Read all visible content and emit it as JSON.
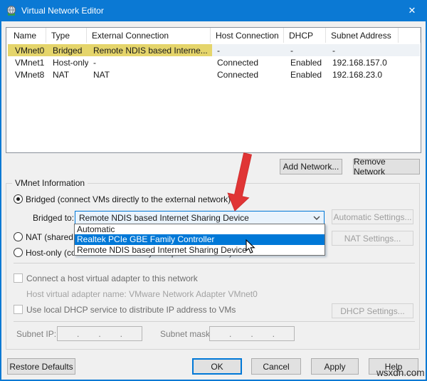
{
  "window": {
    "title": "Virtual Network Editor",
    "close_glyph": "✕"
  },
  "colors": {
    "titlebar": "#0b79d4",
    "selection_yellow": "#e5d56b",
    "selection_inactive": "#eef2f6",
    "highlight_blue": "#0078d7",
    "arrow_red": "#e03535"
  },
  "table": {
    "columns": [
      "Name",
      "Type",
      "External Connection",
      "Host Connection",
      "DHCP",
      "Subnet Address"
    ],
    "rows": [
      [
        "VMnet0",
        "Bridged",
        "Remote NDIS based Interne...",
        "-",
        "-",
        "-"
      ],
      [
        "VMnet1",
        "Host-only",
        "-",
        "Connected",
        "Enabled",
        "192.168.157.0"
      ],
      [
        "VMnet8",
        "NAT",
        "NAT",
        "Connected",
        "Enabled",
        "192.168.23.0"
      ]
    ]
  },
  "actions": {
    "add_network": "Add Network...",
    "remove_network": "Remove Network"
  },
  "vmnet": {
    "group_label": "VMnet Information",
    "bridged_label": "Bridged (connect VMs directly to the external network)",
    "bridged_to_label": "Bridged to:",
    "bridged_to_value": "Remote NDIS based Internet Sharing Device",
    "automatic_settings_label": "Automatic Settings...",
    "nat_label": "NAT (shared host's IP address with VMs)",
    "nat_settings_label": "NAT Settings...",
    "host_only_label": "Host-only (connect VMs internally in a private network)",
    "dropdown": {
      "options": [
        "Automatic",
        "Realtek PCIe GBE Family Controller",
        "Remote NDIS based Internet Sharing Device"
      ],
      "highlighted": "Realtek PCIe GBE Family Controller"
    },
    "connect_adapter_label": "Connect a host virtual adapter to this network",
    "adapter_name_label": "Host virtual adapter name: VMware Network Adapter VMnet0",
    "dhcp_label": "Use local DHCP service to distribute IP address to VMs",
    "dhcp_settings_label": "DHCP Settings...",
    "subnet_ip_label": "Subnet IP:",
    "subnet_mask_label": "Subnet mask:",
    "ip_dot": "."
  },
  "footer": {
    "restore_defaults": "Restore Defaults",
    "ok": "OK",
    "cancel": "Cancel",
    "apply": "Apply",
    "help": "Help"
  },
  "watermark": "wsxdn.com"
}
